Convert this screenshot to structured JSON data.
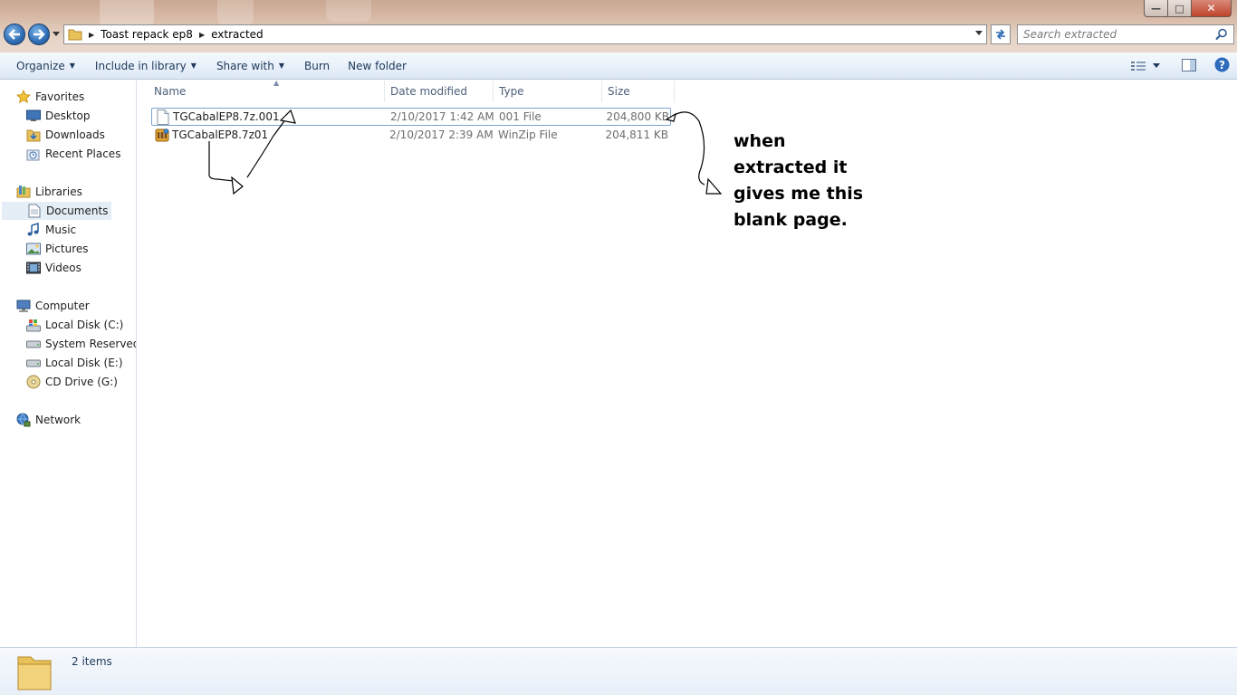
{
  "window": {
    "minimize_glyph": "—",
    "maximize_glyph": "□",
    "close_glyph": "✕"
  },
  "address_bar": {
    "crumbs": [
      "Toast repack ep8",
      "extracted"
    ]
  },
  "search": {
    "placeholder": "Search extracted"
  },
  "toolbar": {
    "organize": "Organize",
    "include_in_library": "Include in library",
    "share_with": "Share with",
    "burn": "Burn",
    "new_folder": "New folder"
  },
  "navigation": {
    "favorites": {
      "label": "Favorites",
      "items": [
        "Desktop",
        "Downloads",
        "Recent Places"
      ]
    },
    "libraries": {
      "label": "Libraries",
      "items": [
        "Documents",
        "Music",
        "Pictures",
        "Videos"
      ],
      "selected": "Documents"
    },
    "computer": {
      "label": "Computer",
      "items": [
        "Local Disk (C:)",
        "System Reserved (D",
        "Local Disk (E:)",
        "CD Drive (G:)"
      ]
    },
    "network": {
      "label": "Network"
    }
  },
  "columns": {
    "name": "Name",
    "date_modified": "Date modified",
    "type": "Type",
    "size": "Size"
  },
  "files": [
    {
      "name": "TGCabalEP8.7z.001",
      "date_modified": "2/10/2017 1:42 AM",
      "type": "001 File",
      "size": "204,800 KB",
      "icon": "generic-file-icon"
    },
    {
      "name": "TGCabalEP8.7z01",
      "date_modified": "2/10/2017 2:39 AM",
      "type": "WinZip File",
      "size": "204,811 KB",
      "icon": "winzip-file-icon"
    }
  ],
  "annotation": {
    "lines": [
      "when",
      "extracted it",
      "gives me this",
      "blank page."
    ]
  },
  "status": {
    "item_count": "2 items"
  },
  "colors": {
    "toolbar_text": "#1e395b",
    "selection": "#e5eef7",
    "focus_border": "#7da2ce"
  }
}
